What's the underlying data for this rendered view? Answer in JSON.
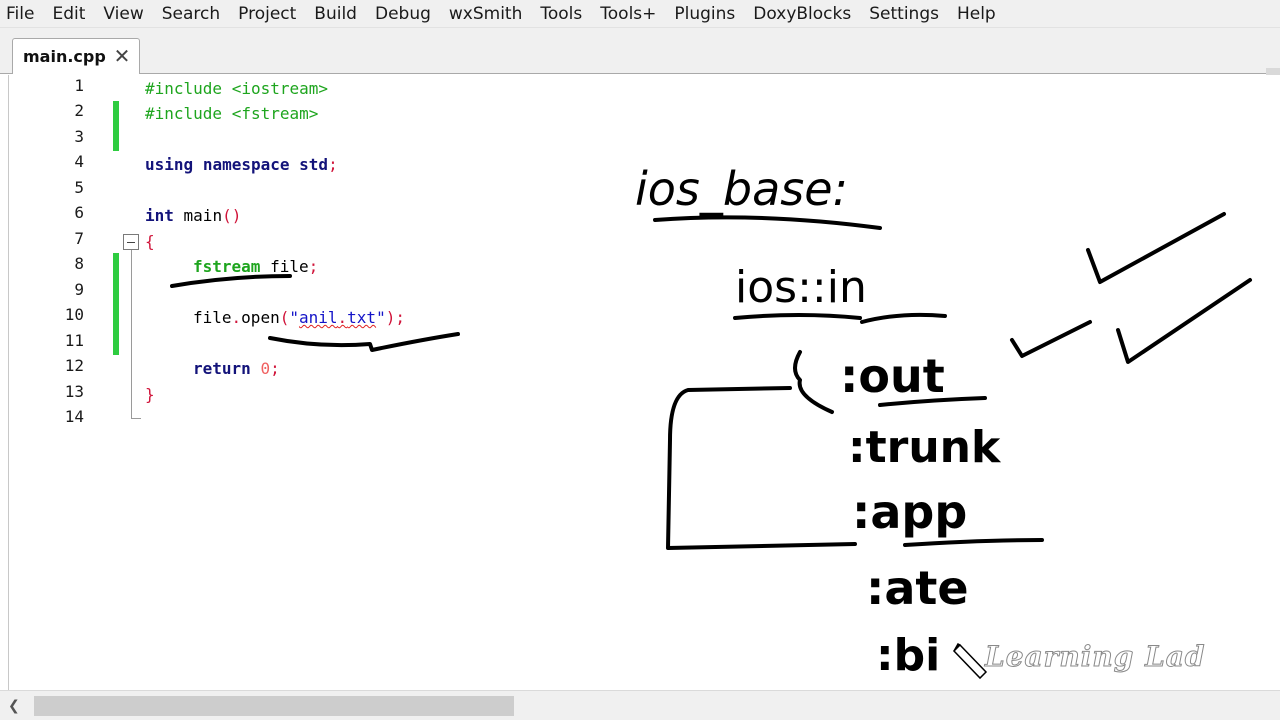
{
  "menu": [
    "File",
    "Edit",
    "View",
    "Search",
    "Project",
    "Build",
    "Debug",
    "wxSmith",
    "Tools",
    "Tools+",
    "Plugins",
    "DoxyBlocks",
    "Settings",
    "Help"
  ],
  "tab": {
    "label": "main.cpp",
    "close": "✕"
  },
  "line_numbers": [
    "1",
    "2",
    "3",
    "4",
    "5",
    "6",
    "7",
    "8",
    "9",
    "10",
    "11",
    "12",
    "13",
    "14"
  ],
  "code": {
    "l1": "#include <iostream>",
    "l2": "#include <fstream>",
    "l4_kw1": "using",
    "l4_kw2": "namespace",
    "l4_kw3": "std",
    "l4_semi": ";",
    "l6_kw": "int",
    "l6_name": " main",
    "l6_parens": "()",
    "l7": "{",
    "l8_type": "fstream",
    "l8_var": " file",
    "l8_semi": ";",
    "l10_obj": "file",
    "l10_dot": ".",
    "l10_fn": "open",
    "l10_lp": "(",
    "l10_q1": "\"",
    "l10_str1": "anil",
    "l10_dot2": ".",
    "l10_str2": "txt",
    "l10_q2": "\"",
    "l10_rp": ");",
    "l12_kw": "return",
    "l12_num": "0",
    "l12_semi": ";",
    "l13": "}"
  },
  "handwriting": {
    "title": "ios_base:",
    "in": "ios::in",
    "out": ":out",
    "trunk": ":trunk",
    "app": ":app",
    "ate": ":ate",
    "bi": ":bi"
  },
  "watermark": "Learning Lad",
  "colors": {
    "change_bar": "#2ecc40",
    "preprocessor": "#1ea51e",
    "keyword": "#13137a"
  }
}
